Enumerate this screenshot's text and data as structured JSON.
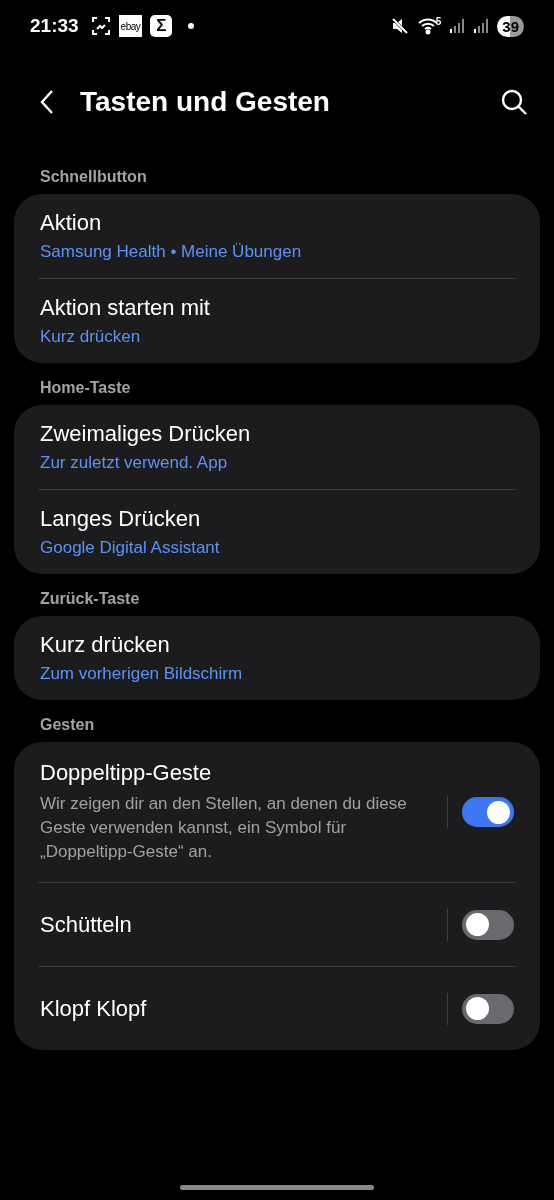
{
  "status_bar": {
    "time": "21:33",
    "app_icons": [
      {
        "kind": "screenshot"
      },
      {
        "kind": "logo",
        "label": "ebay"
      },
      {
        "kind": "glyph",
        "label": "Σ"
      }
    ],
    "network_label": "5",
    "battery": "39"
  },
  "header": {
    "title": "Tasten und Gesten"
  },
  "sections": [
    {
      "title": "Schnellbutton",
      "items": [
        {
          "kind": "link",
          "title": "Aktion",
          "value": "Samsung Health • Meine Übungen"
        },
        {
          "kind": "link",
          "title": "Aktion starten mit",
          "value": "Kurz drücken"
        }
      ]
    },
    {
      "title": "Home-Taste",
      "items": [
        {
          "kind": "link",
          "title": "Zweimaliges Drücken",
          "value": "Zur zuletzt verwend. App"
        },
        {
          "kind": "link",
          "title": "Langes Drücken",
          "value": "Google Digital Assistant"
        }
      ]
    },
    {
      "title": "Zurück-Taste",
      "items": [
        {
          "kind": "link",
          "title": "Kurz drücken",
          "value": "Zum vorherigen Bildschirm"
        }
      ]
    },
    {
      "title": "Gesten",
      "items": [
        {
          "kind": "toggle",
          "title": "Doppeltipp-Geste",
          "description": "Wir zeigen dir an den Stellen, an denen du diese Geste verwenden kannst, ein Symbol für „Doppeltipp-Geste“ an.",
          "on": true
        },
        {
          "kind": "toggle",
          "title": "Schütteln",
          "on": false
        },
        {
          "kind": "toggle",
          "title": "Klopf Klopf",
          "on": false
        }
      ]
    }
  ]
}
